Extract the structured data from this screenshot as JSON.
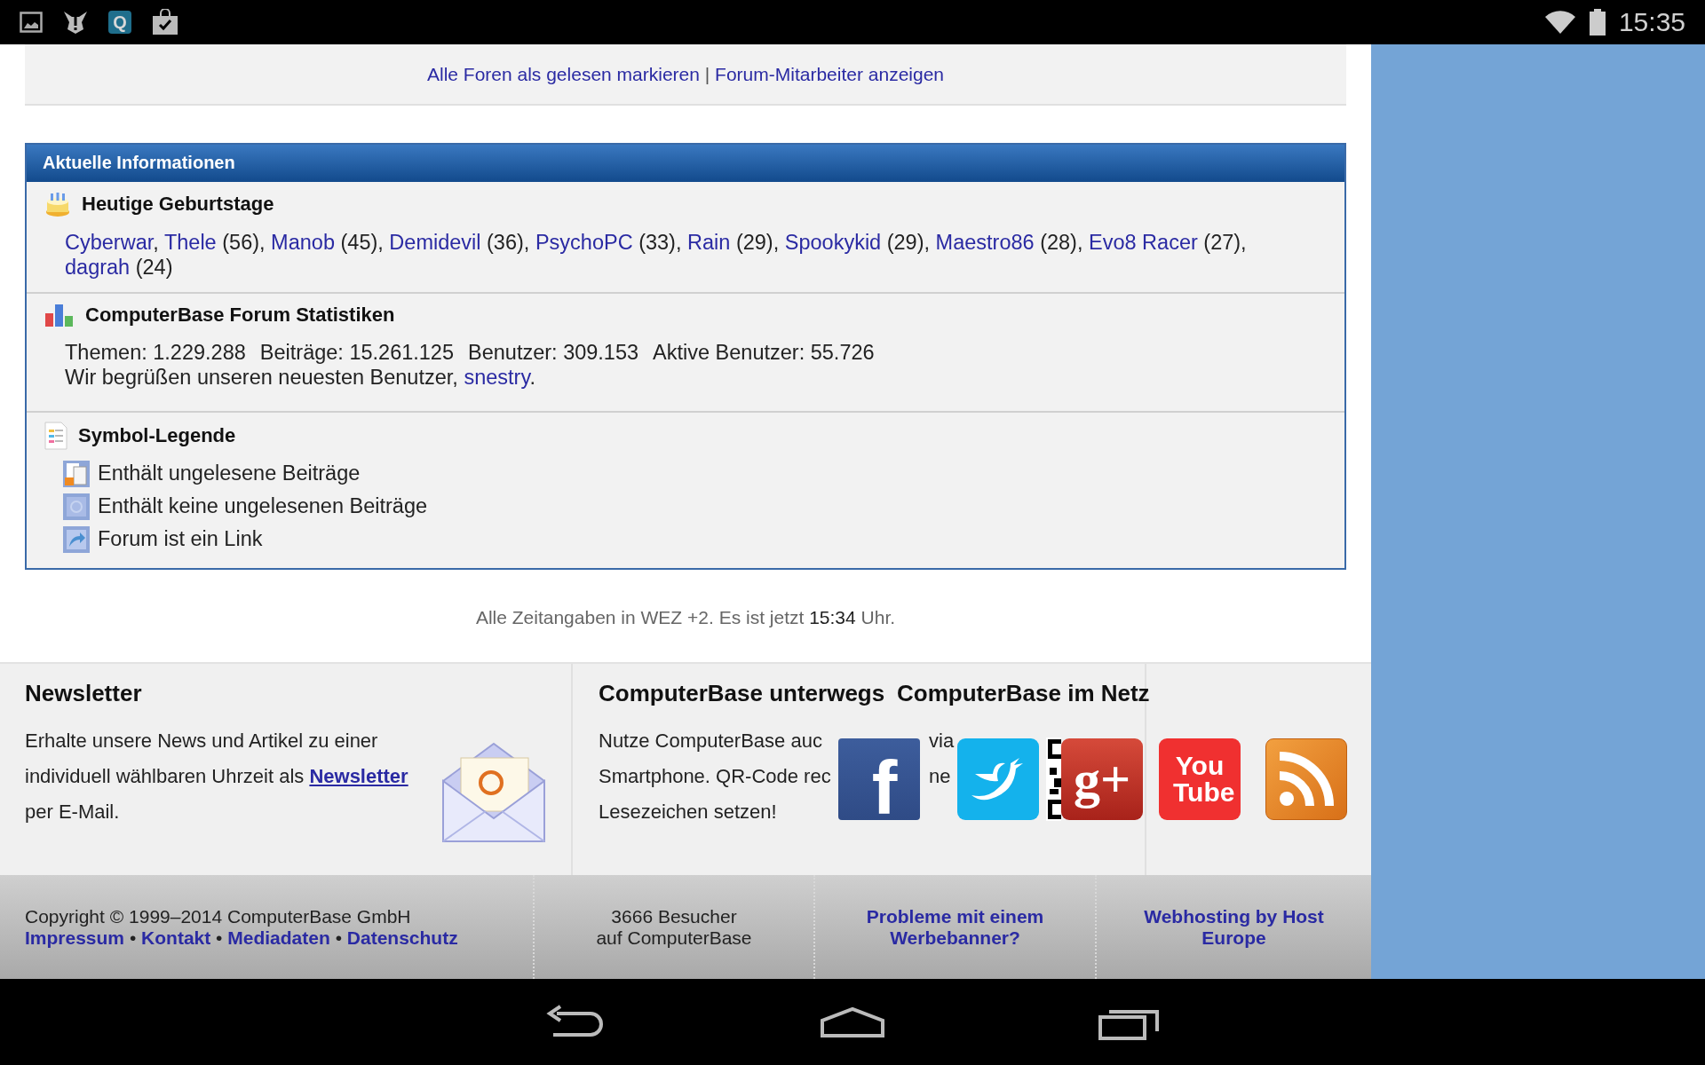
{
  "status_bar": {
    "app_letter": "Q",
    "time": "15:35"
  },
  "top_links": {
    "links": [
      "Alle Foren als gelesen markieren",
      "Forum-Mitarbeiter anzeigen"
    ],
    "separator": "|"
  },
  "info": {
    "title": "Aktuelle Informationen",
    "birthdays": {
      "heading": "Heutige Geburtstage",
      "people": [
        {
          "name": "Cyberwar",
          "after": ","
        },
        {
          "name": "Thele",
          "after": "(56),"
        },
        {
          "name": "Manob",
          "after": "(45),"
        },
        {
          "name": "Demidevil",
          "after": "(36),"
        },
        {
          "name": "PsychoPC",
          "after": "(33),"
        },
        {
          "name": "Rain",
          "after": "(29),"
        },
        {
          "name": "Spookykid",
          "after": "(29),"
        },
        {
          "name": "Maestro86",
          "after": "(28),"
        },
        {
          "name": "Evo8 Racer",
          "after": "(27),"
        },
        {
          "name": "dagrah",
          "after": "(24)"
        }
      ]
    },
    "stats": {
      "heading": "ComputerBase Forum Statistiken",
      "figures": [
        "Themen: 1.229.288",
        "Beiträge: 15.261.125",
        "Benutzer: 309.153",
        "Aktive Benutzer: 55.726"
      ],
      "welcome": "Wir begrüßen unseren neuesten Benutzer,",
      "newest_user": "snestry",
      "welcome_end": "."
    },
    "legend": {
      "heading": "Symbol-Legende",
      "items": [
        {
          "kind": "unread",
          "label": "Enthält ungelesene Beiträge"
        },
        {
          "kind": "read",
          "label": "Enthält keine ungelesenen Beiträge"
        },
        {
          "kind": "link",
          "label": "Forum ist ein Link"
        }
      ]
    }
  },
  "timezone": {
    "text": "Alle Zeitangaben in WEZ +2. Es ist jetzt",
    "time": "15:34",
    "suffix": "Uhr."
  },
  "footer": {
    "newsletter": {
      "heading": "Newsletter",
      "text": "Erhalte unsere News und Artikel zu einer individuell wählbaren Uhrzeit als",
      "link": "Newsletter",
      "text_end": "per E-Mail."
    },
    "mobile": {
      "heading": "ComputerBase unterwegs",
      "lines": [
        {
          "start": "Nutze ComputerBase auc",
          "end": "via"
        },
        {
          "start": "Smartphone. QR-Code rec",
          "end": "ne"
        },
        {
          "start": "Lesezeichen setzen!"
        }
      ]
    },
    "social": {
      "heading": "ComputerBase im Netz",
      "links": [
        {
          "kind": "facebook",
          "glyph": "f"
        },
        {
          "kind": "twitter"
        },
        {
          "kind": "qr"
        },
        {
          "kind": "googleplus",
          "glyph": "g+"
        },
        {
          "kind": "youtube",
          "glyph": "You Tube"
        },
        {
          "kind": "rss"
        }
      ]
    },
    "copyright": "Copyright © 1999–2014 ComputerBase GmbH",
    "legal_links": [
      "Impressum",
      "Kontakt",
      "Mediadaten",
      "Datenschutz"
    ],
    "legal_separator": "•",
    "visitors": [
      "3666 Besucher",
      "auf ComputerBase"
    ],
    "ad_problem_link": "Probleme mit einem Werbebanner?",
    "hosting_link": "Webhosting by Host Europe"
  }
}
